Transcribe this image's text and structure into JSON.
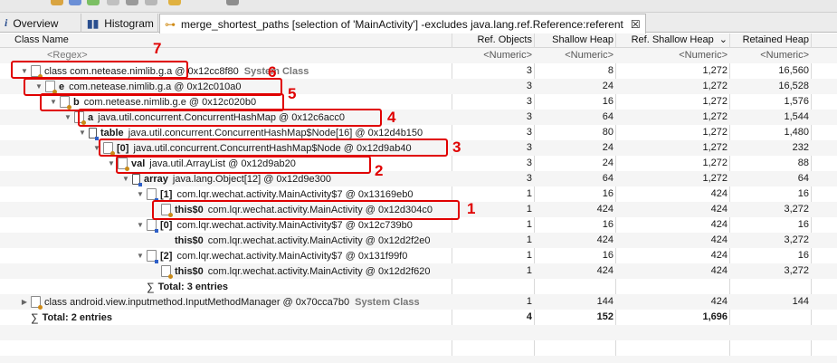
{
  "tabs": [
    {
      "label": "Overview",
      "icon": "info-icon"
    },
    {
      "label": "Histogram",
      "icon": "histogram-icon"
    },
    {
      "label": "merge_shortest_paths  [selection of 'MainActivity'] -excludes java.lang.ref.Reference:referent",
      "icon": "merge-paths-icon",
      "active": true
    }
  ],
  "columns": {
    "class_name": "Class Name",
    "ref_objects": "Ref. Objects",
    "shallow_heap": "Shallow Heap",
    "ref_shallow_heap": "Ref. Shallow Heap",
    "retained_heap": "Retained Heap",
    "sort_indicator": "⌄"
  },
  "filter_row": {
    "class_name": "<Regex>",
    "ref_objects": "<Numeric>",
    "shallow_heap": "<Numeric>",
    "ref_shallow_heap": "<Numeric>",
    "retained_heap": "<Numeric>"
  },
  "rows": [
    {
      "name": "",
      "label": "class com.netease.nimlib.g.a @ 0x12cc8f80",
      "suffix": "System Class",
      "ref": "3",
      "shallow": "8",
      "ref_shallow": "1,272",
      "retained": "16,560"
    },
    {
      "name": "e",
      "label": "com.netease.nimlib.g.a @ 0x12c010a0",
      "suffix": "",
      "ref": "3",
      "shallow": "24",
      "ref_shallow": "1,272",
      "retained": "16,528"
    },
    {
      "name": "b",
      "label": "com.netease.nimlib.g.e @ 0x12c020b0",
      "suffix": "",
      "ref": "3",
      "shallow": "16",
      "ref_shallow": "1,272",
      "retained": "1,576"
    },
    {
      "name": "a",
      "label": "java.util.concurrent.ConcurrentHashMap @ 0x12c6acc0",
      "suffix": "",
      "ref": "3",
      "shallow": "64",
      "ref_shallow": "1,272",
      "retained": "1,544"
    },
    {
      "name": "table",
      "label": "java.util.concurrent.ConcurrentHashMap$Node[16] @ 0x12d4b150",
      "suffix": "",
      "ref": "3",
      "shallow": "80",
      "ref_shallow": "1,272",
      "retained": "1,480"
    },
    {
      "name": "[0]",
      "label": "java.util.concurrent.ConcurrentHashMap$Node @ 0x12d9ab40",
      "suffix": "",
      "ref": "3",
      "shallow": "24",
      "ref_shallow": "1,272",
      "retained": "232"
    },
    {
      "name": "val",
      "label": "java.util.ArrayList @ 0x12d9ab20",
      "suffix": "",
      "ref": "3",
      "shallow": "24",
      "ref_shallow": "1,272",
      "retained": "88"
    },
    {
      "name": "array",
      "label": "java.lang.Object[12] @ 0x12d9e300",
      "suffix": "",
      "ref": "3",
      "shallow": "64",
      "ref_shallow": "1,272",
      "retained": "64"
    },
    {
      "name": "[1]",
      "label": "com.lqr.wechat.activity.MainActivity$7 @ 0x13169eb0",
      "suffix": "",
      "ref": "1",
      "shallow": "16",
      "ref_shallow": "424",
      "retained": "16"
    },
    {
      "name": "this$0",
      "label": "com.lqr.wechat.activity.MainActivity @ 0x12d304c0",
      "suffix": "",
      "ref": "1",
      "shallow": "424",
      "ref_shallow": "424",
      "retained": "3,272"
    },
    {
      "name": "[0]",
      "label": "com.lqr.wechat.activity.MainActivity$7 @ 0x12c739b0",
      "suffix": "",
      "ref": "1",
      "shallow": "16",
      "ref_shallow": "424",
      "retained": "16"
    },
    {
      "name": "this$0",
      "label": "com.lqr.wechat.activity.MainActivity @ 0x12d2f2e0",
      "suffix": "",
      "ref": "1",
      "shallow": "424",
      "ref_shallow": "424",
      "retained": "3,272"
    },
    {
      "name": "[2]",
      "label": "com.lqr.wechat.activity.MainActivity$7 @ 0x131f99f0",
      "suffix": "",
      "ref": "1",
      "shallow": "16",
      "ref_shallow": "424",
      "retained": "16"
    },
    {
      "name": "this$0",
      "label": "com.lqr.wechat.activity.MainActivity @ 0x12d2f620",
      "suffix": "",
      "ref": "1",
      "shallow": "424",
      "ref_shallow": "424",
      "retained": "3,272"
    },
    {
      "name": "",
      "label": "Total: 3 entries",
      "suffix": "",
      "ref": "",
      "shallow": "",
      "ref_shallow": "",
      "retained": ""
    },
    {
      "name": "",
      "label": "class android.view.inputmethod.InputMethodManager @ 0x70cca7b0",
      "suffix": "System Class",
      "ref": "1",
      "shallow": "144",
      "ref_shallow": "424",
      "retained": "144"
    },
    {
      "name": "",
      "label": "Total: 2 entries",
      "suffix": "",
      "ref": "4",
      "shallow": "152",
      "ref_shallow": "1,696",
      "retained": ""
    }
  ],
  "annotations": [
    "7",
    "6",
    "5",
    "4",
    "3",
    "2",
    "1"
  ],
  "colors": {
    "annotation": "#e00000",
    "header_bg": "#f4f4f4",
    "row_alt": "#f5f5f5"
  }
}
